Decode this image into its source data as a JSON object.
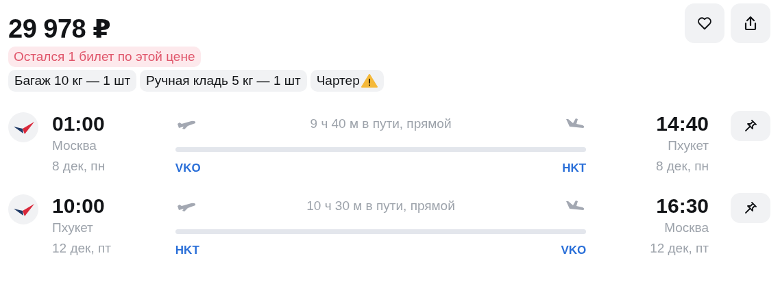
{
  "price": "29 978 ₽",
  "alert": "Остался 1 билет по этой цене",
  "tags": [
    {
      "label": "Багаж 10 кг — 1 шт",
      "warning": false
    },
    {
      "label": "Ручная кладь 5 кг — 1 шт",
      "warning": false
    },
    {
      "label": "Чартер",
      "warning": true
    }
  ],
  "segments": [
    {
      "depart_time": "01:00",
      "depart_city": "Москва",
      "depart_date": "8 дек, пн",
      "duration": "9 ч 40 м в пути, прямой",
      "from_code": "VKO",
      "to_code": "HKT",
      "arrive_time": "14:40",
      "arrive_city": "Пхукет",
      "arrive_date": "8 дек, пн"
    },
    {
      "depart_time": "10:00",
      "depart_city": "Пхукет",
      "depart_date": "12 дек, пт",
      "duration": "10 ч 30 м в пути, прямой",
      "from_code": "HKT",
      "to_code": "VKO",
      "arrive_time": "16:30",
      "arrive_city": "Москва",
      "arrive_date": "12 дек, пт"
    }
  ]
}
